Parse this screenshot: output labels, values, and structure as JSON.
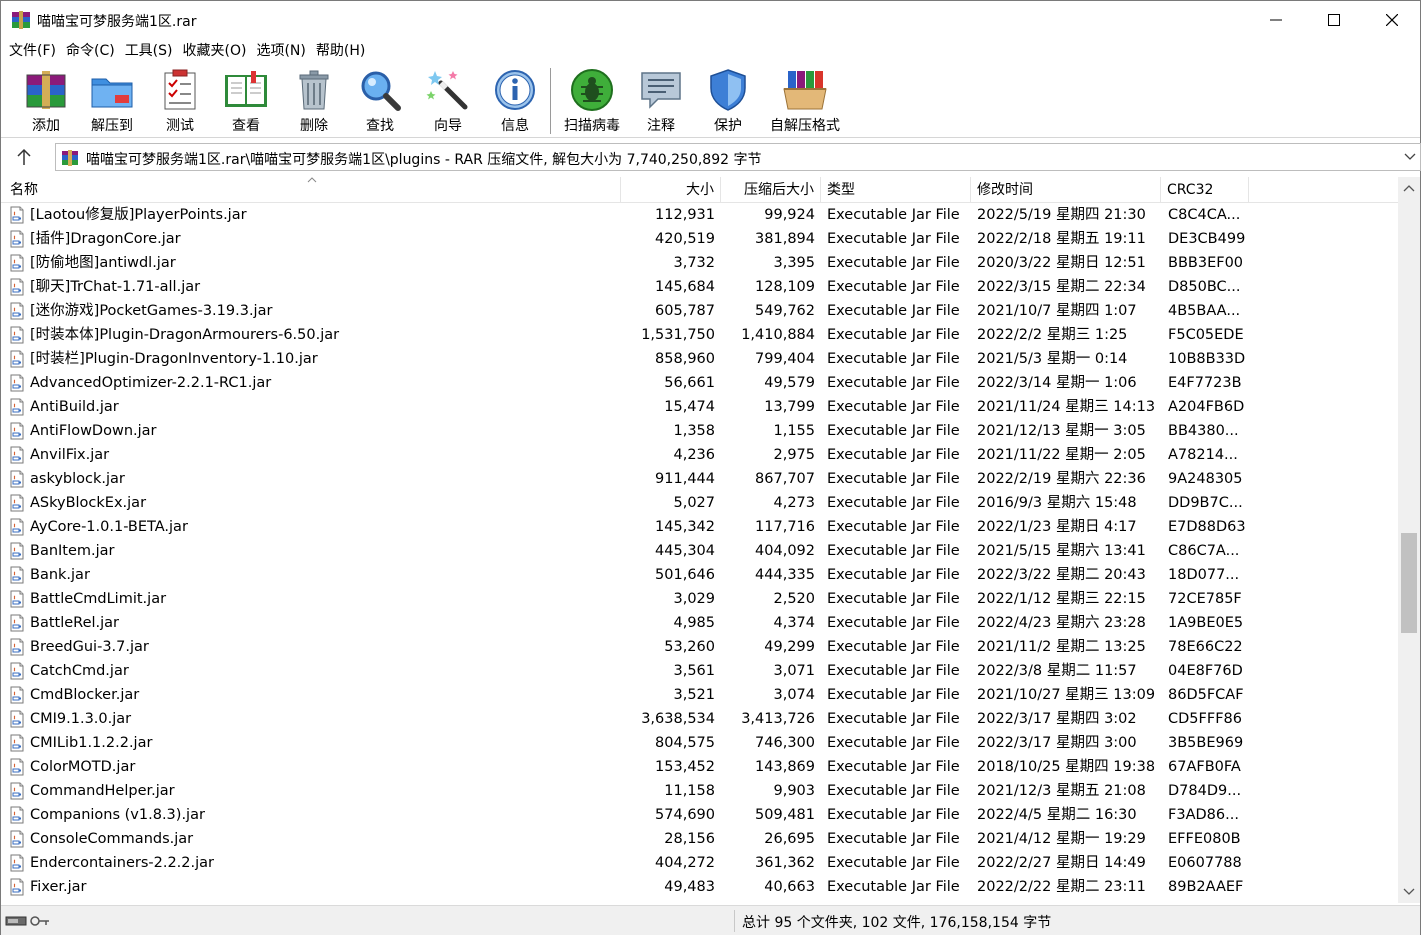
{
  "window": {
    "title": "喵喵宝可梦服务端1区.rar"
  },
  "menu": [
    "文件(F)",
    "命令(C)",
    "工具(S)",
    "收藏夹(O)",
    "选项(N)",
    "帮助(H)"
  ],
  "toolbar": [
    {
      "label": "添加",
      "icon": "add-archive-icon"
    },
    {
      "label": "解压到",
      "icon": "extract-to-icon"
    },
    {
      "label": "测试",
      "icon": "test-icon"
    },
    {
      "label": "查看",
      "icon": "view-icon"
    },
    {
      "label": "删除",
      "icon": "delete-icon"
    },
    {
      "label": "查找",
      "icon": "find-icon"
    },
    {
      "label": "向导",
      "icon": "wizard-icon"
    },
    {
      "label": "信息",
      "icon": "info-icon"
    },
    {
      "label": "扫描病毒",
      "icon": "virus-scan-icon"
    },
    {
      "label": "注释",
      "icon": "comment-icon"
    },
    {
      "label": "保护",
      "icon": "protect-icon"
    },
    {
      "label": "自解压格式",
      "icon": "sfx-icon"
    }
  ],
  "address": {
    "path": "喵喵宝可梦服务端1区.rar\\喵喵宝可梦服务端1区\\plugins - RAR 压缩文件, 解包大小为 7,740,250,892 字节"
  },
  "columns": {
    "name": "名称",
    "size": "大小",
    "packed": "压缩后大小",
    "type": "类型",
    "modified": "修改时间",
    "crc": "CRC32"
  },
  "files": [
    {
      "name": "[Laotou修复版]PlayerPoints.jar",
      "size": "112,931",
      "packed": "99,924",
      "type": "Executable Jar File",
      "modified": "2022/5/19 星期四 21:30",
      "crc": "C8C4CA..."
    },
    {
      "name": "[插件]DragonCore.jar",
      "size": "420,519",
      "packed": "381,894",
      "type": "Executable Jar File",
      "modified": "2022/2/18 星期五 19:11",
      "crc": "DE3CB499"
    },
    {
      "name": "[防偷地图]antiwdl.jar",
      "size": "3,732",
      "packed": "3,395",
      "type": "Executable Jar File",
      "modified": "2020/3/22 星期日 12:51",
      "crc": "BBB3EF00"
    },
    {
      "name": "[聊天]TrChat-1.71-all.jar",
      "size": "145,684",
      "packed": "128,109",
      "type": "Executable Jar File",
      "modified": "2022/3/15 星期二 22:34",
      "crc": "D850BC..."
    },
    {
      "name": "[迷你游戏]PocketGames-3.19.3.jar",
      "size": "605,787",
      "packed": "549,762",
      "type": "Executable Jar File",
      "modified": "2021/10/7 星期四 1:07",
      "crc": "4B5BAA..."
    },
    {
      "name": "[时装本体]Plugin-DragonArmourers-6.50.jar",
      "size": "1,531,750",
      "packed": "1,410,884",
      "type": "Executable Jar File",
      "modified": "2022/2/2 星期三 1:25",
      "crc": "F5C05EDE"
    },
    {
      "name": "[时装栏]Plugin-DragonInventory-1.10.jar",
      "size": "858,960",
      "packed": "799,404",
      "type": "Executable Jar File",
      "modified": "2021/5/3 星期一 0:14",
      "crc": "10B8B33D"
    },
    {
      "name": "AdvancedOptimizer-2.2.1-RC1.jar",
      "size": "56,661",
      "packed": "49,579",
      "type": "Executable Jar File",
      "modified": "2022/3/14 星期一 1:06",
      "crc": "E4F7723B"
    },
    {
      "name": "AntiBuild.jar",
      "size": "15,474",
      "packed": "13,799",
      "type": "Executable Jar File",
      "modified": "2021/11/24 星期三 14:13",
      "crc": "A204FB6D"
    },
    {
      "name": "AntiFlowDown.jar",
      "size": "1,358",
      "packed": "1,155",
      "type": "Executable Jar File",
      "modified": "2021/12/13 星期一 3:05",
      "crc": "BB4380..."
    },
    {
      "name": "AnvilFix.jar",
      "size": "4,236",
      "packed": "2,975",
      "type": "Executable Jar File",
      "modified": "2021/11/22 星期一 2:05",
      "crc": "A78214..."
    },
    {
      "name": "askyblock.jar",
      "size": "911,444",
      "packed": "867,707",
      "type": "Executable Jar File",
      "modified": "2022/2/19 星期六 22:36",
      "crc": "9A248305"
    },
    {
      "name": "ASkyBlockEx.jar",
      "size": "5,027",
      "packed": "4,273",
      "type": "Executable Jar File",
      "modified": "2016/9/3 星期六 15:48",
      "crc": "DD9B7C..."
    },
    {
      "name": "AyCore-1.0.1-BETA.jar",
      "size": "145,342",
      "packed": "117,716",
      "type": "Executable Jar File",
      "modified": "2022/1/23 星期日 4:17",
      "crc": "E7D88D63"
    },
    {
      "name": "BanItem.jar",
      "size": "445,304",
      "packed": "404,092",
      "type": "Executable Jar File",
      "modified": "2021/5/15 星期六 13:41",
      "crc": "C86C7A..."
    },
    {
      "name": "Bank.jar",
      "size": "501,646",
      "packed": "444,335",
      "type": "Executable Jar File",
      "modified": "2022/3/22 星期二 20:43",
      "crc": "18D077..."
    },
    {
      "name": "BattleCmdLimit.jar",
      "size": "3,029",
      "packed": "2,520",
      "type": "Executable Jar File",
      "modified": "2022/1/12 星期三 22:15",
      "crc": "72CE785F"
    },
    {
      "name": "BattleRel.jar",
      "size": "4,985",
      "packed": "4,374",
      "type": "Executable Jar File",
      "modified": "2022/4/23 星期六 23:28",
      "crc": "1A9BE0E5"
    },
    {
      "name": "BreedGui-3.7.jar",
      "size": "53,260",
      "packed": "49,299",
      "type": "Executable Jar File",
      "modified": "2021/11/2 星期二 13:25",
      "crc": "78E66C22"
    },
    {
      "name": "CatchCmd.jar",
      "size": "3,561",
      "packed": "3,071",
      "type": "Executable Jar File",
      "modified": "2022/3/8 星期二 11:57",
      "crc": "04E8F76D"
    },
    {
      "name": "CmdBlocker.jar",
      "size": "3,521",
      "packed": "3,074",
      "type": "Executable Jar File",
      "modified": "2021/10/27 星期三 13:09",
      "crc": "86D5FCAF"
    },
    {
      "name": "CMI9.1.3.0.jar",
      "size": "3,638,534",
      "packed": "3,413,726",
      "type": "Executable Jar File",
      "modified": "2022/3/17 星期四 3:02",
      "crc": "CD5FFF86"
    },
    {
      "name": "CMILib1.1.2.2.jar",
      "size": "804,575",
      "packed": "746,300",
      "type": "Executable Jar File",
      "modified": "2022/3/17 星期四 3:00",
      "crc": "3B5BE969"
    },
    {
      "name": "ColorMOTD.jar",
      "size": "153,452",
      "packed": "143,869",
      "type": "Executable Jar File",
      "modified": "2018/10/25 星期四 19:38",
      "crc": "67AFB0FA"
    },
    {
      "name": "CommandHelper.jar",
      "size": "11,158",
      "packed": "9,903",
      "type": "Executable Jar File",
      "modified": "2021/12/3 星期五 21:08",
      "crc": "D784D9..."
    },
    {
      "name": "Companions (v1.8.3).jar",
      "size": "574,690",
      "packed": "509,481",
      "type": "Executable Jar File",
      "modified": "2022/4/5 星期二 16:30",
      "crc": "F3AD86..."
    },
    {
      "name": "ConsoleCommands.jar",
      "size": "28,156",
      "packed": "26,695",
      "type": "Executable Jar File",
      "modified": "2021/4/12 星期一 19:29",
      "crc": "EFFE080B"
    },
    {
      "name": "Endercontainers-2.2.2.jar",
      "size": "404,272",
      "packed": "361,362",
      "type": "Executable Jar File",
      "modified": "2022/2/27 星期日 14:49",
      "crc": "E0607788"
    },
    {
      "name": "Fixer.jar",
      "size": "49,483",
      "packed": "40,663",
      "type": "Executable Jar File",
      "modified": "2022/2/22 星期二 23:11",
      "crc": "89B2AAEF"
    }
  ],
  "status": {
    "summary": "总计 95 个文件夹, 102 文件, 176,158,154 字节"
  }
}
